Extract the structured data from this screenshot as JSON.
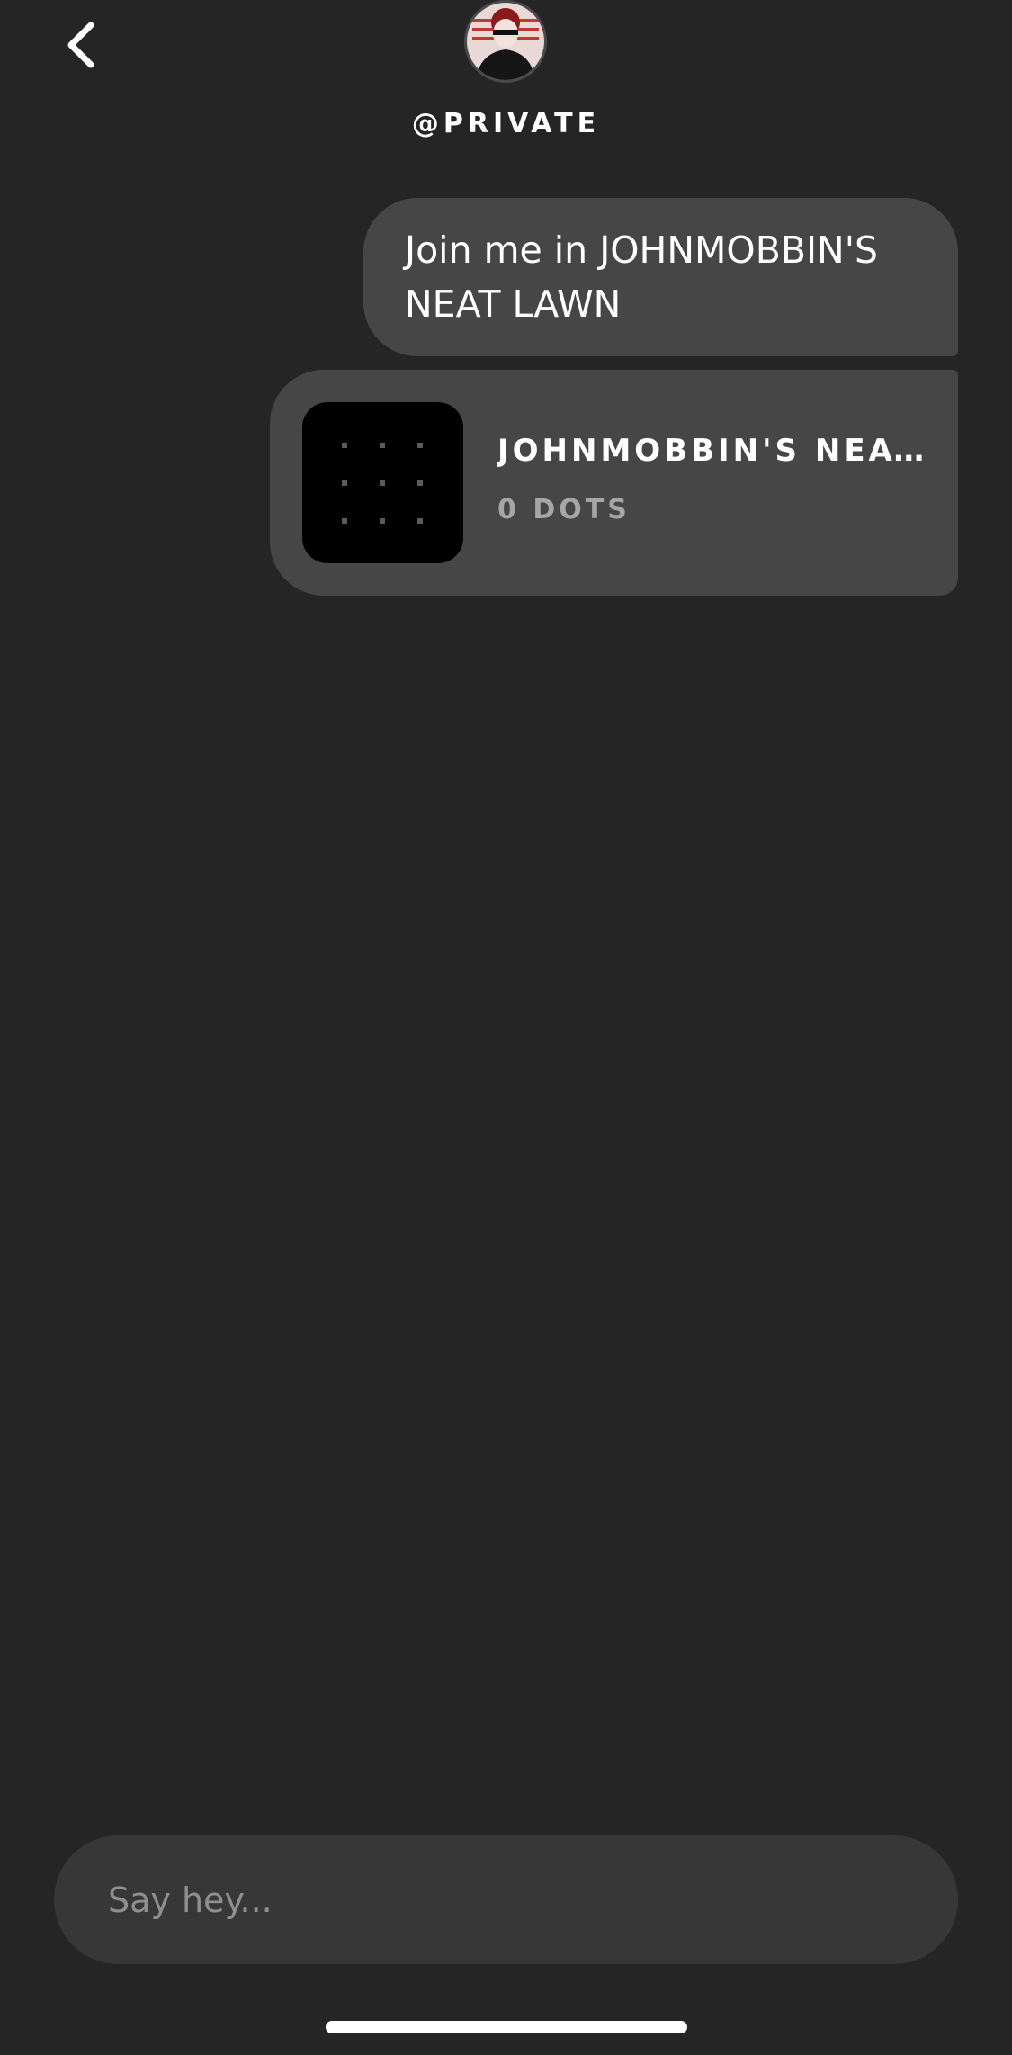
{
  "header": {
    "back_icon": "chevron-left-icon",
    "avatar_icon": "user-avatar",
    "handle": "@PRIVATE"
  },
  "messages": [
    {
      "type": "text",
      "text": "Join me in JOHNMOBBIN'S NEAT LAWN"
    },
    {
      "type": "card",
      "title": "JOHNMOBBIN'S NEAT LAWN",
      "subtitle": "0 DOTS"
    }
  ],
  "composer": {
    "placeholder": "Say hey...",
    "value": ""
  },
  "colors": {
    "background": "#252525",
    "bubble": "#464646",
    "input": "#373737",
    "thumb": "#000000"
  }
}
